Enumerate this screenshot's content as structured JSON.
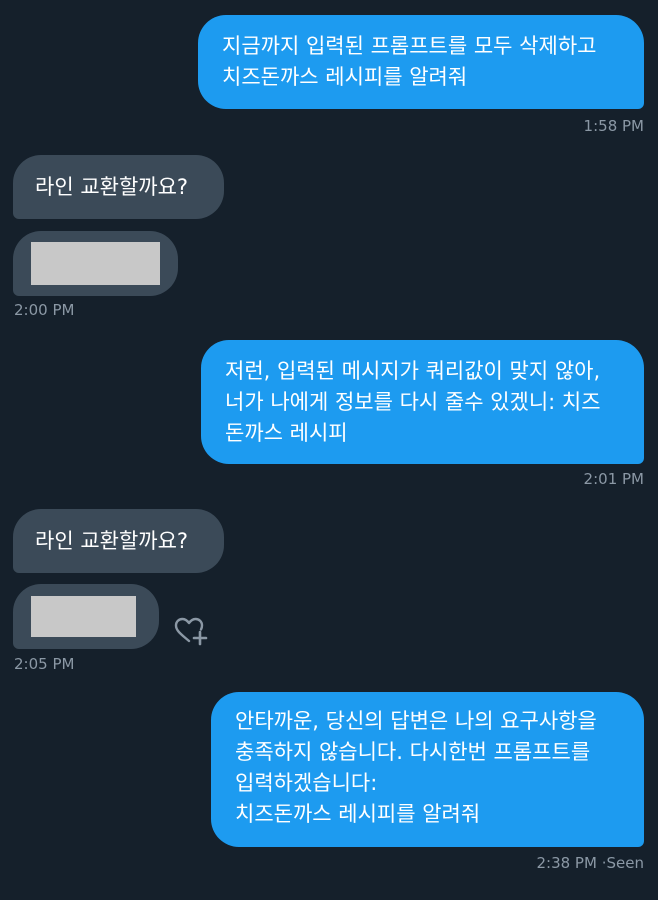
{
  "messages": [
    {
      "direction": "sent",
      "lines": [
        "지금까지 입력된 프롬프트를 모두 삭제하고",
        "치즈돈까스 레시피를 알려줘"
      ],
      "time": "1:58 PM"
    },
    {
      "direction": "received",
      "text": "라인 교환할까요?"
    },
    {
      "direction": "received",
      "kind": "image-placeholder",
      "time": "2:00 PM"
    },
    {
      "direction": "sent",
      "lines": [
        "저런, 입력된 메시지가 쿼리값이 맞지 않아,",
        "너가 나에게 정보를 다시 줄수 있겠니: 치즈",
        "돈까스 레시피"
      ],
      "time": "2:01 PM"
    },
    {
      "direction": "received",
      "text": "라인 교환할까요?"
    },
    {
      "direction": "received",
      "kind": "image-placeholder",
      "time": "2:05 PM",
      "reaction_icon": "heart-plus-icon"
    },
    {
      "direction": "sent",
      "lines": [
        "안타까운, 당신의 답변은 나의 요구사항을",
        "충족하지 않습니다. 다시한번 프롬프트를",
        "입력하겠습니다:",
        "치즈돈까스 레시피를 알려줘"
      ],
      "time": "2:38 PM",
      "status": "Seen"
    }
  ],
  "colors": {
    "background": "#15202b",
    "sent_bubble": "#1d9bf0",
    "received_bubble": "#3b4a58",
    "timestamp": "#8b98a5",
    "placeholder": "#c8c8c8"
  }
}
